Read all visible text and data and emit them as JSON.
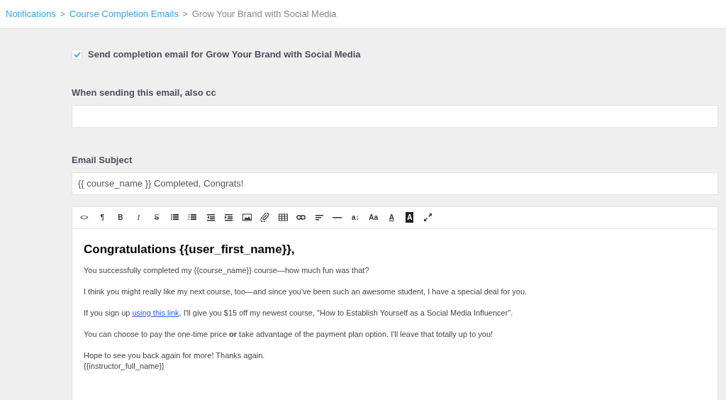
{
  "breadcrumb": [
    {
      "label": "Notifications",
      "link": true
    },
    {
      "separator": ">",
      "label": "Course Completion Emails",
      "link": true
    },
    {
      "separator": ">",
      "label": "Grow Your Brand with Social Media",
      "link": false
    }
  ],
  "send_checkbox": {
    "label": "Send completion email for Grow Your Brand with Social Media",
    "checked": true
  },
  "cc_field": {
    "label": "When sending this email, also cc"
  },
  "subject_field": {
    "label": "Email Subject",
    "value": "{{ course_name }} Completed, Congrats!"
  },
  "toolbar": [
    {
      "kind": "code",
      "glyph": "<>"
    },
    {
      "kind": "text",
      "glyph": "¶"
    },
    {
      "kind": "bold",
      "glyph": "B"
    },
    {
      "kind": "italic",
      "glyph": "I"
    },
    {
      "kind": "strike",
      "glyph": "S"
    },
    {
      "kind": "bullets"
    },
    {
      "kind": "numbers"
    },
    {
      "kind": "outdent"
    },
    {
      "kind": "indent"
    },
    {
      "kind": "image"
    },
    {
      "kind": "attach"
    },
    {
      "kind": "table"
    },
    {
      "kind": "link"
    },
    {
      "kind": "align"
    },
    {
      "kind": "rule"
    },
    {
      "kind": "text",
      "glyph": "a↕"
    },
    {
      "kind": "text",
      "glyph": "Aa"
    },
    {
      "kind": "underline",
      "glyph": "A"
    },
    {
      "kind": "inverse",
      "glyph": "A"
    },
    {
      "kind": "fullscreen"
    }
  ],
  "body": {
    "heading": "Congratulations {{user_first_name}},",
    "paragraphs": [
      {
        "text": "You successfully completed my {{course_name}} course—how much fun was that?"
      },
      {
        "text": "I think you might really like my next course, too—and since you've been such an awesome student, I have a special deal for you."
      },
      {
        "before": "If you sign up ",
        "link": "using this link",
        "after": ", I'll give you $15 off my newest course, \"How to Establish Yourself as a Social Media Influencer\"."
      },
      {
        "text": "You can choose to pay the one-time price **or** take advantage of the payment plan option. I'll leave that totally up to you!"
      },
      {
        "lines": [
          "Hope to see you back again for more! Thanks again.",
          "{{instructor_full_name}}"
        ]
      }
    ]
  }
}
